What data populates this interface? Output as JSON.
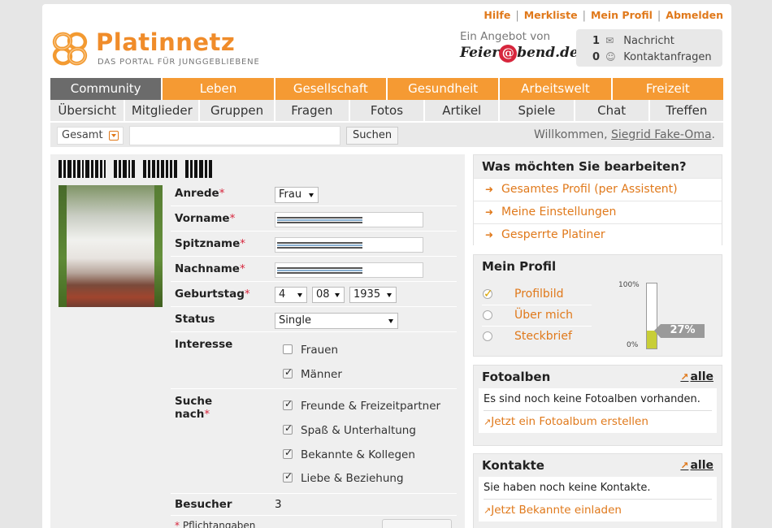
{
  "toplinks": [
    "Hilfe",
    "Merkliste",
    "Mein Profil",
    "Abmelden"
  ],
  "logo": {
    "name": "Platinnetz",
    "tagline": "DAS PORTAL FÜR JUNGGEBLIEBENE"
  },
  "offer": {
    "label": "Ein Angebot von",
    "brand_before": "Feier",
    "brand_at": "@",
    "brand_after": "bend.de"
  },
  "notify": {
    "messages": {
      "count": "1",
      "label": "Nachricht",
      "icon": "envelope-icon"
    },
    "contacts": {
      "count": "0",
      "label": "Kontaktanfragen",
      "icon": "contact-request-icon"
    }
  },
  "mainnav": [
    "Community",
    "Leben",
    "Gesellschaft",
    "Gesundheit",
    "Arbeitswelt",
    "Freizeit"
  ],
  "subnav": [
    "Übersicht",
    "Mitglieder",
    "Gruppen",
    "Fragen",
    "Fotos",
    "Artikel",
    "Spiele",
    "Chat",
    "Treffen"
  ],
  "search": {
    "scope": "Gesamt",
    "button": "Suchen",
    "welcome": "Willkommen,",
    "user": "Siegrid Fake-Oma",
    "period": "."
  },
  "form": {
    "anrede": {
      "label": "Anrede",
      "value": "Frau"
    },
    "vorname": {
      "label": "Vorname"
    },
    "spitzname": {
      "label": "Spitzname"
    },
    "nachname": {
      "label": "Nachname"
    },
    "geburtstag": {
      "label": "Geburtstag",
      "day": "4",
      "month": "08",
      "year": "1935"
    },
    "status": {
      "label": "Status",
      "value": "Single"
    },
    "interesse": {
      "label": "Interesse",
      "options": [
        {
          "label": "Frauen",
          "checked": false
        },
        {
          "label": "Männer",
          "checked": true
        }
      ]
    },
    "suche": {
      "label_line1": "Suche",
      "label_line2": "nach",
      "options": [
        {
          "label": "Freunde & Freizeitpartner",
          "checked": true
        },
        {
          "label": "Spaß & Unterhaltung",
          "checked": true
        },
        {
          "label": "Bekannte & Kollegen",
          "checked": true
        },
        {
          "label": "Liebe & Beziehung",
          "checked": true
        }
      ]
    },
    "besucher": {
      "label": "Besucher",
      "value": "3"
    },
    "mandatory": {
      "asterisk": "*",
      "text": "Pflichtangaben"
    }
  },
  "edit_box": {
    "title": "Was möchten Sie bearbeiten?",
    "items": [
      "Gesamtes Profil (per Assistent)",
      "Meine Einstellungen",
      "Gesperrte Platiner"
    ]
  },
  "profile_box": {
    "title": "Mein Profil",
    "items": [
      {
        "label": "Profilbild",
        "done": true
      },
      {
        "label": "Über mich",
        "done": false
      },
      {
        "label": "Steckbrief",
        "done": false
      }
    ],
    "gauge_max": "100%",
    "gauge_min": "0%",
    "percent": "27%",
    "percent_value": 27
  },
  "photo_box": {
    "title": "Fotoalben",
    "all": "alle",
    "empty": "Es sind noch keine Fotoalben vorhanden.",
    "action": "Jetzt ein Fotoalbum erstellen"
  },
  "contacts_box": {
    "title": "Kontakte",
    "all": "alle",
    "empty": "Sie haben noch keine Kontakte.",
    "action": "Jetzt Bekannte einladen"
  },
  "colors": {
    "accent": "#f59a33",
    "link": "#e0791b",
    "active_tab": "#6b6b6b",
    "required": "#d7263d"
  }
}
